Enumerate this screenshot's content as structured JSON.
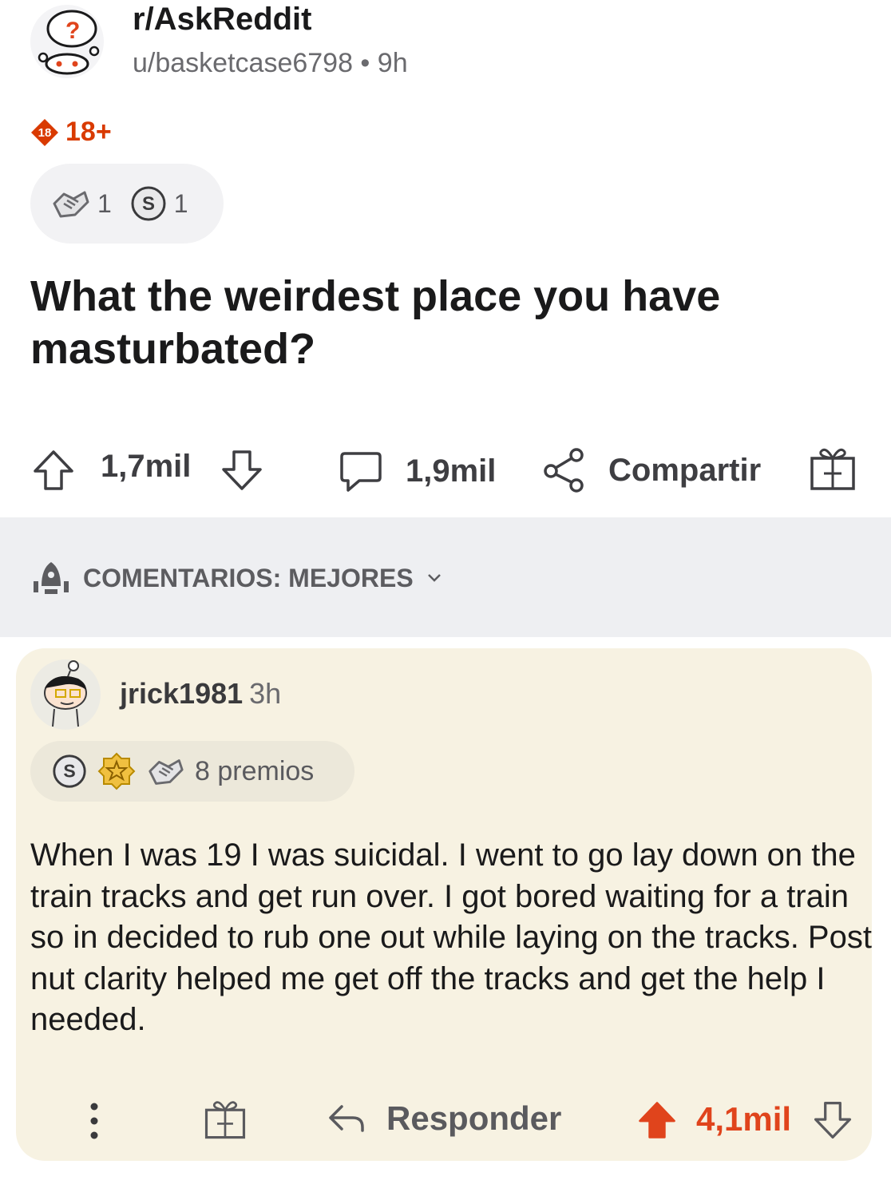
{
  "post": {
    "subreddit": "r/AskReddit",
    "author_line": "u/basketcase6798 • 9h",
    "nsfw_badge": "18",
    "nsfw_label": "18+",
    "awards": [
      {
        "icon": "wholesome-handshake-icon",
        "count": "1"
      },
      {
        "icon": "silver-award-icon",
        "count": "1"
      }
    ],
    "title": "What the weirdest place you have masturbated?",
    "upvotes": "1,7mil",
    "comments": "1,9mil",
    "share_label": "Compartir"
  },
  "sort": {
    "label": "COMENTARIOS: MEJORES"
  },
  "comment": {
    "username": "jrick1981",
    "time": "3h",
    "awards_label": "8 premios",
    "award_icons": [
      "silver-award-icon",
      "gold-award-icon",
      "wholesome-handshake-icon"
    ],
    "body": "When I was 19 I was suicidal. I went to go lay down on the train tracks and get run over. I got bored waiting for a train so in decided to rub one out while laying on the tracks. Post nut clarity helped me get off the tracks and get the help I needed.",
    "reply_label": "Responder",
    "score": "4,1mil"
  },
  "colors": {
    "accent_orange": "#e0441c",
    "nsfw_red": "#d93a00",
    "card_bg": "#f7f2e2",
    "sort_bar_bg": "#eeeff2"
  }
}
